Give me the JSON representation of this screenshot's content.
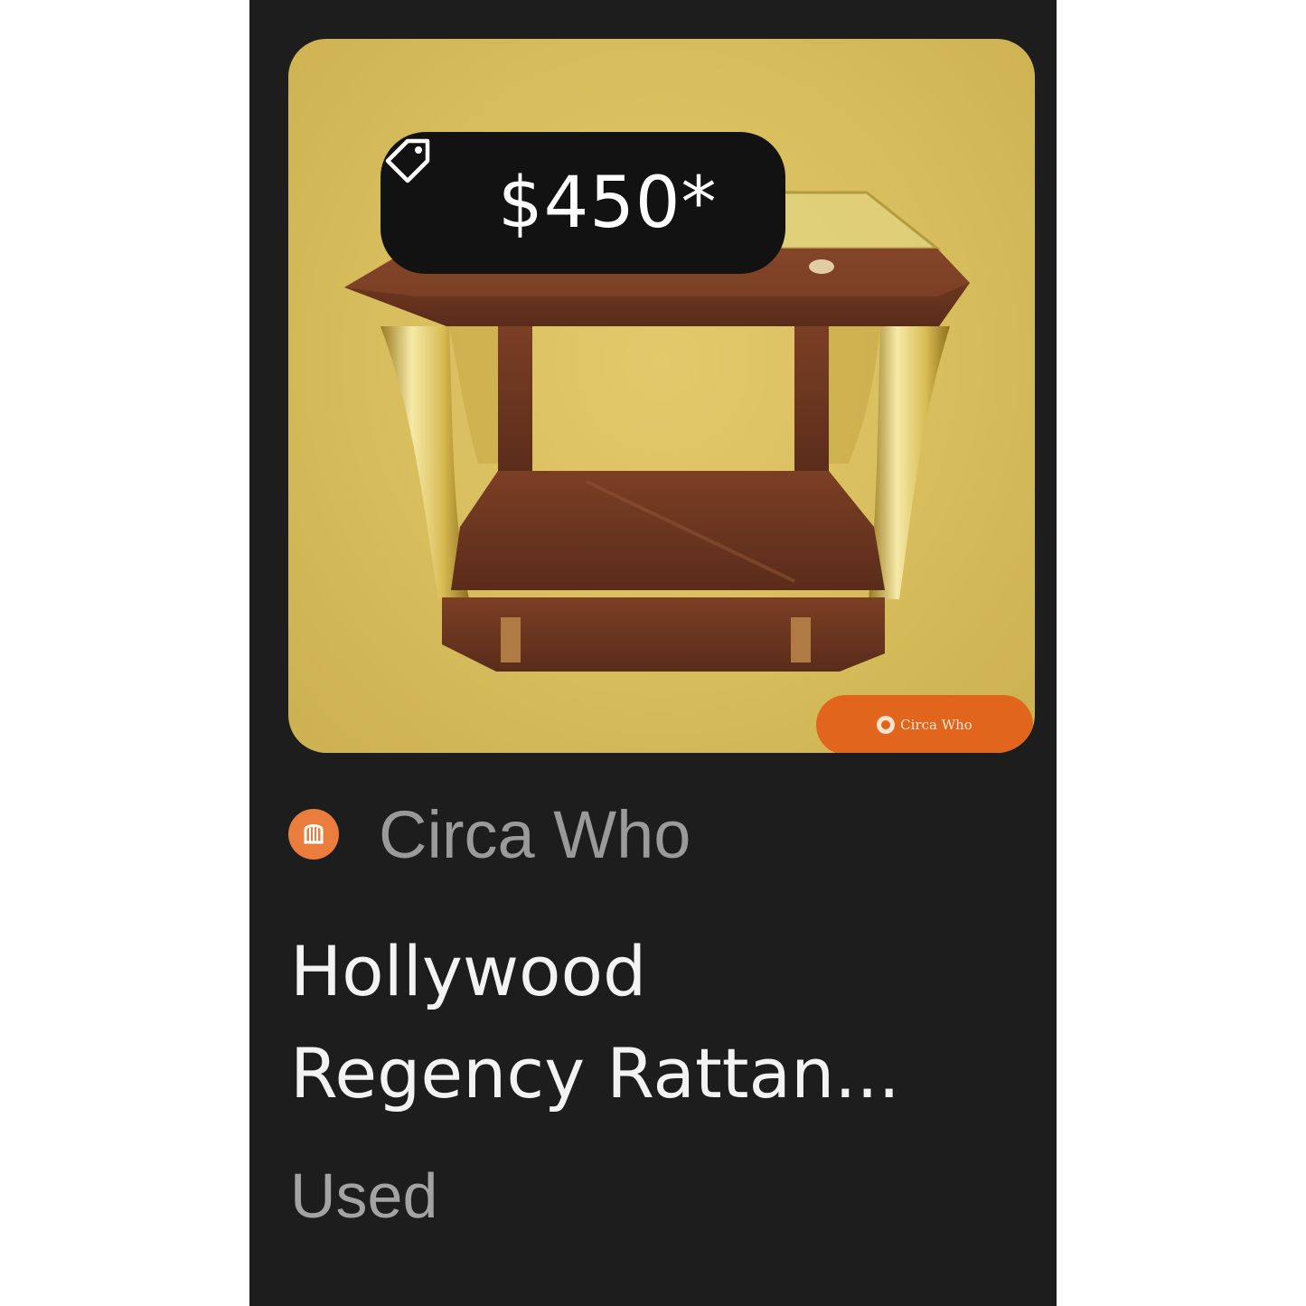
{
  "listing": {
    "price": "$450*",
    "seller_name": "Circa Who",
    "title_line1": "Hollywood",
    "title_line2": "Regency Rattan...",
    "condition": "Used",
    "watermark_text": "Circa Who"
  },
  "icons": {
    "price": "tag-icon",
    "seller": "seller-avatar-icon"
  },
  "colors": {
    "card_background": "#1d1d1d",
    "badge_background": "#121212",
    "photo_background": "#d7bd5c",
    "avatar_orange": "#ea7d3d",
    "watermark_orange": "#e2651e"
  }
}
